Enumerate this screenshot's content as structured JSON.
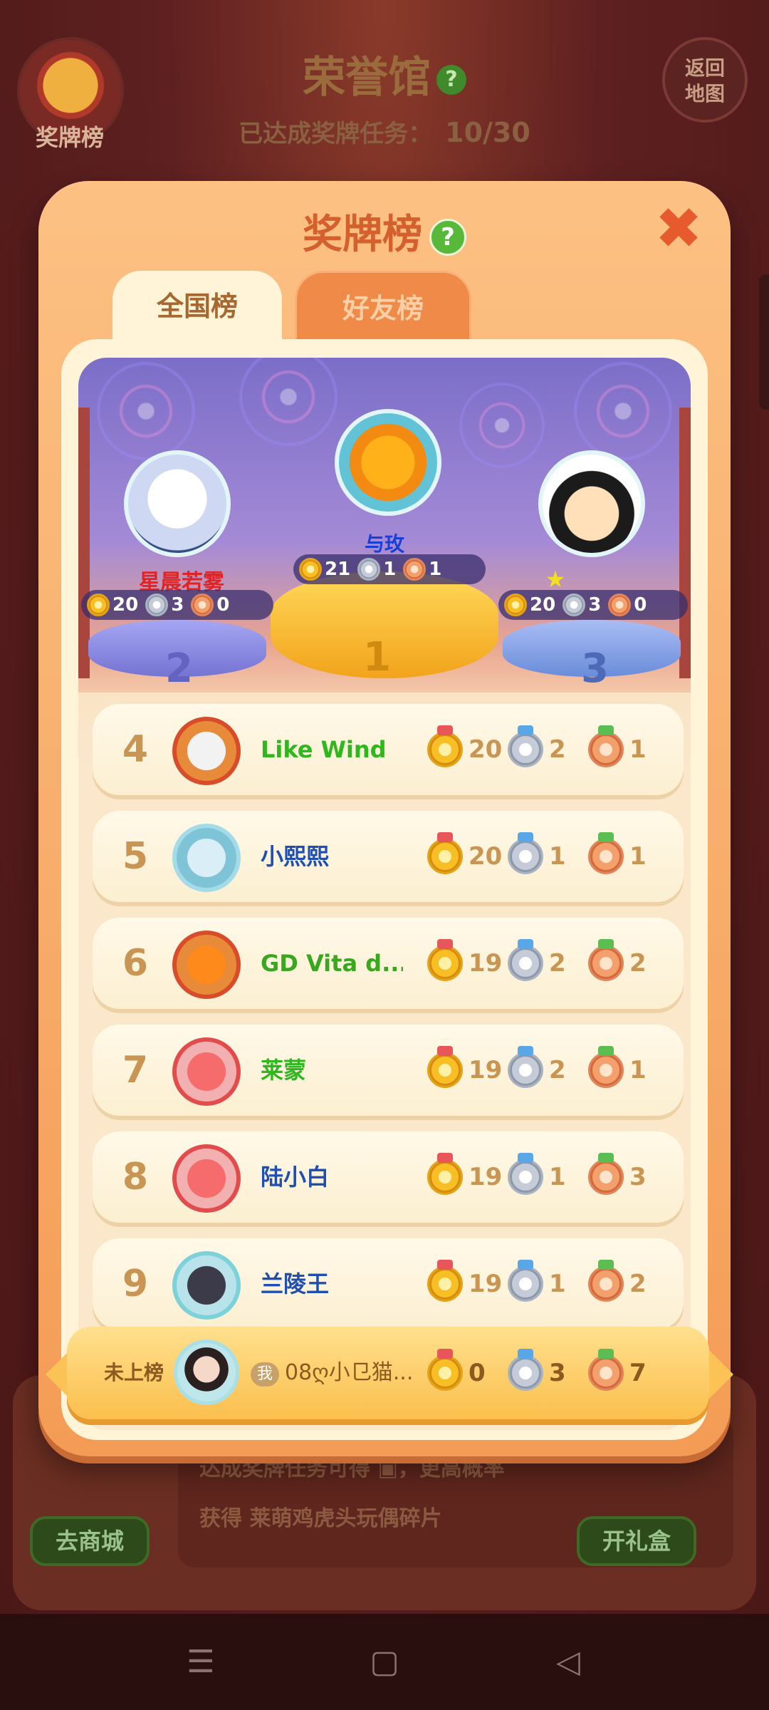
{
  "background": {
    "medal_button_label": "奖牌榜",
    "title": "荣誉馆",
    "progress_label": "已达成奖牌任务：",
    "progress_value": "10/30",
    "back_button": [
      "返回",
      "地图"
    ],
    "info_line_1": "达成奖牌任务可得",
    "info_line_1b": "，更高概率",
    "info_line_2": "获得 莱萌鸡虎头玩偶碎片",
    "shop_button": "去商城",
    "gift_button": "开礼盒"
  },
  "modal": {
    "title": "奖牌榜",
    "help_icon": "?",
    "close_icon": "✖",
    "tabs": [
      {
        "label": "全国榜",
        "active": true
      },
      {
        "label": "好友榜",
        "active": false
      }
    ]
  },
  "podium": {
    "first": {
      "rank": "1",
      "name": "与玫",
      "gold": "21",
      "silver": "1",
      "bronze": "1"
    },
    "second": {
      "rank": "2",
      "name": "星晨若雾",
      "gold": "20",
      "silver": "3",
      "bronze": "0"
    },
    "third": {
      "rank": "3",
      "name": "★",
      "gold": "20",
      "silver": "3",
      "bronze": "0"
    }
  },
  "ranking": [
    {
      "rank": "4",
      "name": "Like  Wind",
      "gold": "20",
      "silver": "2",
      "bronze": "1"
    },
    {
      "rank": "5",
      "name": "小熙熙",
      "gold": "20",
      "silver": "1",
      "bronze": "1"
    },
    {
      "rank": "6",
      "name": "GD Vita d...",
      "gold": "19",
      "silver": "2",
      "bronze": "2"
    },
    {
      "rank": "7",
      "name": "莱蒙",
      "gold": "19",
      "silver": "2",
      "bronze": "1"
    },
    {
      "rank": "8",
      "name": "陆小白",
      "gold": "19",
      "silver": "1",
      "bronze": "3"
    },
    {
      "rank": "9",
      "name": "兰陵王",
      "gold": "19",
      "silver": "1",
      "bronze": "2"
    }
  ],
  "me": {
    "status": "未上榜",
    "badge": "我",
    "name": "08ღ小⺋猫...",
    "gold": "0",
    "silver": "3",
    "bronze": "7"
  },
  "nav": {
    "menu_icon": "☰",
    "home_icon": "▢",
    "back_icon": "◁"
  }
}
